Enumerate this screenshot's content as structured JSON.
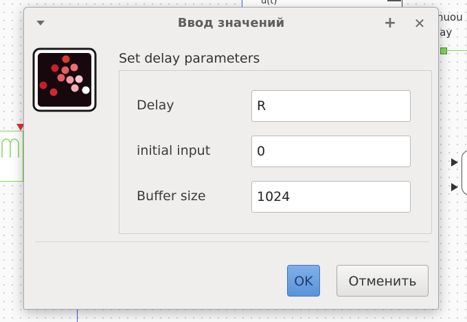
{
  "dialog": {
    "title": "Ввод значений",
    "heading": "Set delay parameters",
    "pin_glyph": "+",
    "close_glyph": "✕",
    "fields": [
      {
        "label": "Delay",
        "value": "R"
      },
      {
        "label": "initial input",
        "value": "0"
      },
      {
        "label": "Buffer size",
        "value": "1024"
      }
    ],
    "ok_label": "OK",
    "cancel_label": "Отменить"
  },
  "background": {
    "block_text": "u(t)",
    "side_text_line1": "nuou",
    "side_text_line2": "lay"
  },
  "icons": {
    "menu": "dropdown-triangle-icon",
    "pin": "plus-icon",
    "close": "close-icon",
    "app": "scilab-dots-icon"
  },
  "colors": {
    "ok_button": "#5b93d9",
    "dialog_bg": "#efeeed",
    "link_green": "#7ed957",
    "wire_blue": "#3b5bdb"
  }
}
